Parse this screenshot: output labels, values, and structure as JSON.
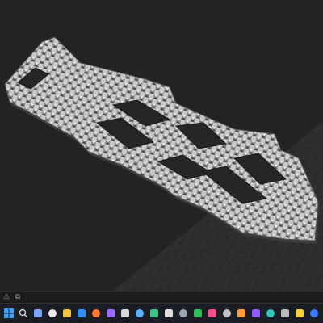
{
  "viewport": {
    "background": "#232323",
    "part": {
      "name": "carbon-frame-plate",
      "texture": "carbon-weave",
      "base_color": "#bdbdbd",
      "edge_color": "#3a3a3a"
    },
    "build_plate": {
      "grid": true,
      "color": "#303030",
      "grid_color": "#474747"
    }
  },
  "bottom_strip": {
    "buttons": [
      {
        "icon": "warning-icon",
        "glyph": "⚠"
      },
      {
        "icon": "copy-icon",
        "glyph": "⧉"
      }
    ]
  },
  "taskbar": {
    "icons": [
      {
        "name": "windows-start-icon",
        "color": "#3aa3ff"
      },
      {
        "name": "search-icon",
        "color": "#cfd3da"
      },
      {
        "name": "task-view-icon",
        "color": "#7da6ff"
      },
      {
        "name": "slicer-app-icon",
        "color": "#e8e8e8"
      },
      {
        "name": "file-explorer-icon",
        "color": "#f2c744"
      },
      {
        "name": "browser-icon",
        "color": "#2f8ff0"
      },
      {
        "name": "firefox-icon",
        "color": "#ff7a2f"
      },
      {
        "name": "media-icon",
        "color": "#9f6cff"
      },
      {
        "name": "circle-app-icon",
        "color": "#d8d8d8"
      },
      {
        "name": "mail-icon",
        "color": "#5ab0ff"
      },
      {
        "name": "photos-icon",
        "color": "#3fc38a"
      },
      {
        "name": "calendar-icon",
        "color": "#e0e0e0"
      },
      {
        "name": "settings-icon",
        "color": "#9aa4b2"
      },
      {
        "name": "green-app-icon",
        "color": "#2fbf5a"
      },
      {
        "name": "pink-app-icon",
        "color": "#ff4f8b"
      },
      {
        "name": "terminal-icon",
        "color": "#c0c0c0"
      },
      {
        "name": "orange-app-icon",
        "color": "#ff9b3b"
      },
      {
        "name": "purple-app-icon",
        "color": "#8e5cff"
      },
      {
        "name": "teal-app-icon",
        "color": "#2ec7c0"
      },
      {
        "name": "grid-app-icon",
        "color": "#bbbbbb"
      },
      {
        "name": "yellow-app-icon",
        "color": "#f2d23c"
      },
      {
        "name": "blue-app-icon",
        "color": "#3c7dff"
      },
      {
        "name": "steam-icon",
        "color": "#7fa7d8"
      }
    ]
  }
}
